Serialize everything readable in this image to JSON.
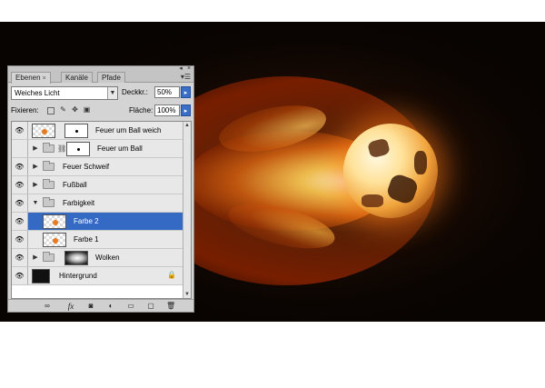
{
  "panel": {
    "tabs": [
      {
        "label": "Ebenen",
        "active": true,
        "close": "×"
      },
      {
        "label": "Kanäle",
        "active": false
      },
      {
        "label": "Pfade",
        "active": false
      }
    ],
    "blend_mode": "Weiches Licht",
    "opacity_label": "Deckkr.:",
    "opacity_value": "50%",
    "lock_label": "Fixieren:",
    "fill_label": "Fläche:",
    "fill_value": "100%",
    "layers": [
      {
        "name": "Feuer um Ball weich",
        "visible": true,
        "type": "layer-with-mask"
      },
      {
        "name": "Feuer um Ball",
        "visible": false,
        "type": "group-with-mask"
      },
      {
        "name": "Feuer Schweif",
        "visible": true,
        "type": "group"
      },
      {
        "name": "Fußball",
        "visible": true,
        "type": "group"
      },
      {
        "name": "Farbigkeit",
        "visible": true,
        "type": "group-open"
      },
      {
        "name": "Farbe 2",
        "visible": true,
        "type": "layer",
        "selected": true
      },
      {
        "name": "Farbe 1",
        "visible": true,
        "type": "layer"
      },
      {
        "name": "Wolken",
        "visible": true,
        "type": "group-with-mask"
      },
      {
        "name": "Hintergrund",
        "visible": true,
        "type": "background"
      }
    ]
  },
  "colors": {
    "selection": "#3469c4",
    "canvas_bg": "#0b0502",
    "fire": "#ff8c1e"
  }
}
